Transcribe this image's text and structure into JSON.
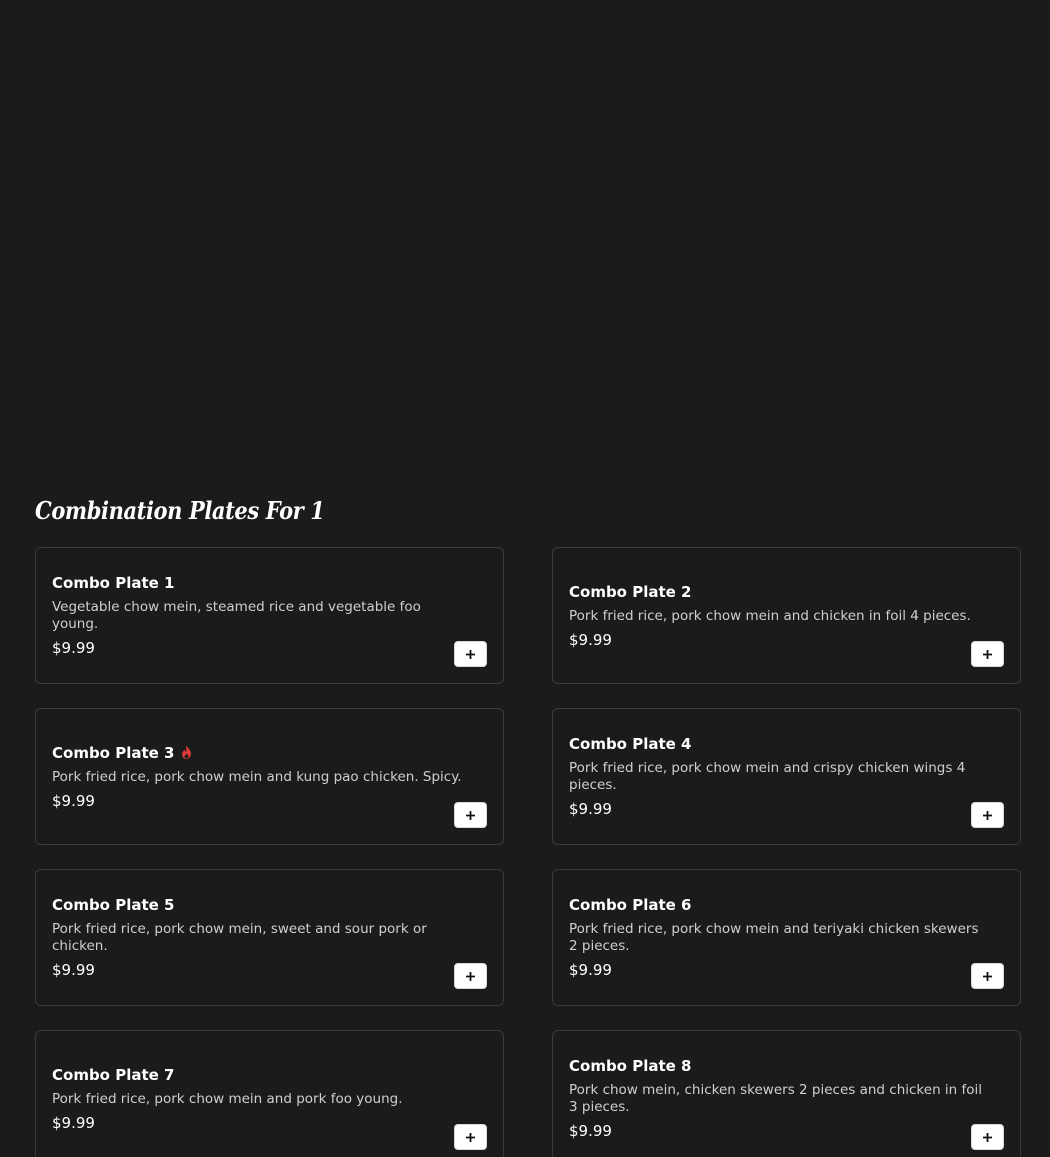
{
  "section": {
    "title": "Combination Plates For 1"
  },
  "accent_colors": {
    "spicy": "#e23b3b",
    "card_border": "#3b3b3b",
    "background": "#1b1b1b"
  },
  "items": [
    {
      "name": "Combo Plate 1",
      "description": "Vegetable chow mein, steamed rice and vegetable foo young.",
      "price": "$9.99",
      "spicy": false,
      "add_icon": "plus-icon"
    },
    {
      "name": "Combo Plate 2",
      "description": "Pork fried rice, pork chow mein and chicken in foil 4 pieces.",
      "price": "$9.99",
      "spicy": false,
      "add_icon": "plus-icon"
    },
    {
      "name": "Combo Plate 3",
      "description": "Pork fried rice, pork chow mein and kung pao chicken. Spicy.",
      "price": "$9.99",
      "spicy": true,
      "spicy_icon": "flame-icon",
      "add_icon": "plus-icon"
    },
    {
      "name": "Combo Plate 4",
      "description": "Pork fried rice, pork chow mein and crispy chicken wings 4 pieces.",
      "price": "$9.99",
      "spicy": false,
      "add_icon": "plus-icon"
    },
    {
      "name": "Combo Plate 5",
      "description": "Pork fried rice, pork chow mein, sweet and sour pork or chicken.",
      "price": "$9.99",
      "spicy": false,
      "add_icon": "plus-icon"
    },
    {
      "name": "Combo Plate 6",
      "description": "Pork fried rice, pork chow mein and teriyaki chicken skewers 2 pieces.",
      "price": "$9.99",
      "spicy": false,
      "add_icon": "plus-icon"
    },
    {
      "name": "Combo Plate 7",
      "description": "Pork fried rice, pork chow mein and pork foo young.",
      "price": "$9.99",
      "spicy": false,
      "add_icon": "plus-icon"
    },
    {
      "name": "Combo Plate 8",
      "description": "Pork chow mein, chicken skewers 2 pieces and chicken in foil 3 pieces.",
      "price": "$9.99",
      "spicy": false,
      "add_icon": "plus-icon"
    }
  ]
}
